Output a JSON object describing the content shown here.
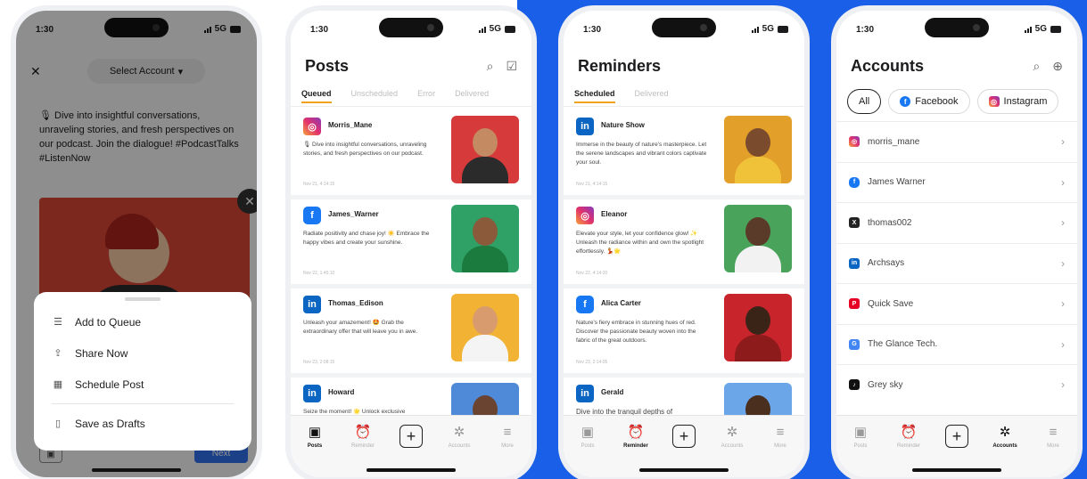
{
  "phone1": {
    "time": "1:30",
    "network": "5G",
    "close_icon": "close-icon",
    "select_account_label": "Select Account",
    "post_text": "🎙 Dive into insightful conversations, unraveling stories, and fresh perspectives on our podcast. Join the dialogue! #PodcastTalks #ListenNow",
    "sheet_items": [
      {
        "label": "Add to Queue",
        "icon": "queue-icon"
      },
      {
        "label": "Share Now",
        "icon": "share-icon"
      },
      {
        "label": "Schedule Post",
        "icon": "calendar-icon"
      },
      {
        "label": "Save as Drafts",
        "icon": "draft-icon"
      }
    ],
    "next_label": "Next"
  },
  "phone2": {
    "time": "1:30",
    "network": "5G",
    "title": "Posts",
    "tabs": [
      "Queued",
      "Unscheduled",
      "Error",
      "Delivered"
    ],
    "cards": [
      {
        "platform": "instagram",
        "name": "Morris_Mane",
        "text": "🎙 Dive into insightful conversations, unraveling stories, and fresh perspectives on our podcast.",
        "date": "Nov 21, 4:14:15"
      },
      {
        "platform": "facebook",
        "name": "James_Warner",
        "text": "Radiate positivity and chase joy! ☀️ Embrace the happy vibes and create your sunshine.",
        "date": "Nov 22, 1:45:10"
      },
      {
        "platform": "linkedin",
        "name": "Thomas_Edison",
        "text": "Unleash your amazement! 🤩 Grab the extraordinary offer that will leave you in awe.",
        "date": "Nov 23, 2:08:15"
      },
      {
        "platform": "linkedin",
        "name": "Howard",
        "text": "Seize the moment! 🌟 Unlock exclusive",
        "date": ""
      }
    ],
    "tabbar": [
      "Posts",
      "Reminder",
      "",
      "Accounts",
      "More"
    ]
  },
  "phone3": {
    "time": "1:30",
    "network": "5G",
    "title": "Reminders",
    "tabs": [
      "Scheduled",
      "Delivered"
    ],
    "cards": [
      {
        "platform": "linkedin",
        "name": "Nature Show",
        "text": "Immerse in the beauty of nature's masterpiece. Let the serene landscapes and vibrant colors captivate your soul.",
        "date": "Nov 21, 4:14:15"
      },
      {
        "platform": "instagram",
        "name": "Eleanor",
        "text": "Elevate your style, let your confidence glow! ✨ Unleash the radiance within and own the spotlight effortlessly. 💃🌟",
        "date": "Nov 22, 4:14:20"
      },
      {
        "platform": "facebook",
        "name": "Alica Carter",
        "text": "Nature's fiery embrace in stunning hues of red. Discover the passionate beauty woven into the fabric of the great outdoors.",
        "date": "Nov 23, 2:14:05"
      },
      {
        "platform": "linkedin",
        "name": "Gerald",
        "text": "Dive into the tranquil depths of",
        "date": ""
      }
    ],
    "tabbar": [
      "Posts",
      "Reminder",
      "",
      "Accounts",
      "More"
    ]
  },
  "phone4": {
    "time": "1:30",
    "network": "5G",
    "title": "Accounts",
    "chips": [
      "All",
      "Facebook",
      "Instagram"
    ],
    "accounts": [
      {
        "name": "morris_mane",
        "platform": "instagram"
      },
      {
        "name": "James Warner",
        "platform": "facebook"
      },
      {
        "name": "thomas002",
        "platform": "x"
      },
      {
        "name": "Archsays",
        "platform": "linkedin"
      },
      {
        "name": "Quick Save",
        "platform": "pinterest"
      },
      {
        "name": "The Glance Tech.",
        "platform": "google-business"
      },
      {
        "name": "Grey sky",
        "platform": "tiktok"
      }
    ],
    "tabbar": [
      "Posts",
      "Reminder",
      "",
      "Accounts",
      "More"
    ]
  },
  "colors": {
    "accent_blue": "#1a5fe8",
    "tab_underline": "#f1a21c",
    "facebook": "#1877f2",
    "linkedin": "#0a66c2"
  }
}
